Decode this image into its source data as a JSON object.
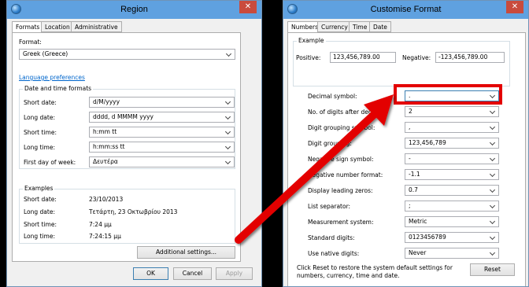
{
  "region": {
    "title": "Region",
    "close_label": "✕",
    "tabs": [
      {
        "label": "Formats",
        "active": true
      },
      {
        "label": "Location",
        "active": false
      },
      {
        "label": "Administrative",
        "active": false
      }
    ],
    "format_label": "Format:",
    "format_value": "Greek (Greece)",
    "language_link": "Language preferences",
    "date_time_group": "Date and time formats",
    "fields": [
      {
        "label": "Short date:",
        "value": "d/M/yyyy"
      },
      {
        "label": "Long date:",
        "value": "dddd, d MMMM yyyy"
      },
      {
        "label": "Short time:",
        "value": "h:mm tt"
      },
      {
        "label": "Long time:",
        "value": "h:mm:ss tt"
      },
      {
        "label": "First day of week:",
        "value": "Δευτέρα"
      }
    ],
    "examples_group": "Examples",
    "examples": [
      {
        "label": "Short date:",
        "value": "23/10/2013"
      },
      {
        "label": "Long date:",
        "value": "Τετάρτη, 23 Οκτωβρίου 2013"
      },
      {
        "label": "Short time:",
        "value": "7:24 μμ"
      },
      {
        "label": "Long time:",
        "value": "7:24:15 μμ"
      }
    ],
    "additional_settings": "Additional settings...",
    "ok": "OK",
    "cancel": "Cancel",
    "apply": "Apply"
  },
  "customise": {
    "title": "Customise Format",
    "close_label": "✕",
    "tabs": [
      {
        "label": "Numbers",
        "active": true
      },
      {
        "label": "Currency",
        "active": false
      },
      {
        "label": "Time",
        "active": false
      },
      {
        "label": "Date",
        "active": false
      }
    ],
    "example_group": "Example",
    "positive_label": "Positive:",
    "positive_value": "123,456,789.00",
    "negative_label": "Negative:",
    "negative_value": "-123,456,789.00",
    "settings": [
      {
        "label": "Decimal symbol:",
        "value": "."
      },
      {
        "label": "No. of digits after decimal:",
        "value": "2"
      },
      {
        "label": "Digit grouping symbol:",
        "value": ","
      },
      {
        "label": "Digit grouping:",
        "value": "123,456,789"
      },
      {
        "label": "Negative sign symbol:",
        "value": "-"
      },
      {
        "label": "Negative number format:",
        "value": "-1.1"
      },
      {
        "label": "Display leading zeros:",
        "value": "0.7"
      },
      {
        "label": "List separator:",
        "value": ";"
      },
      {
        "label": "Measurement system:",
        "value": "Metric"
      },
      {
        "label": "Standard digits:",
        "value": "0123456789"
      },
      {
        "label": "Use native digits:",
        "value": "Never"
      }
    ],
    "reset_text": "Click Reset to restore the system default settings for numbers, currency, time and date.",
    "reset": "Reset"
  },
  "annotation": {
    "color": "#e30000"
  }
}
